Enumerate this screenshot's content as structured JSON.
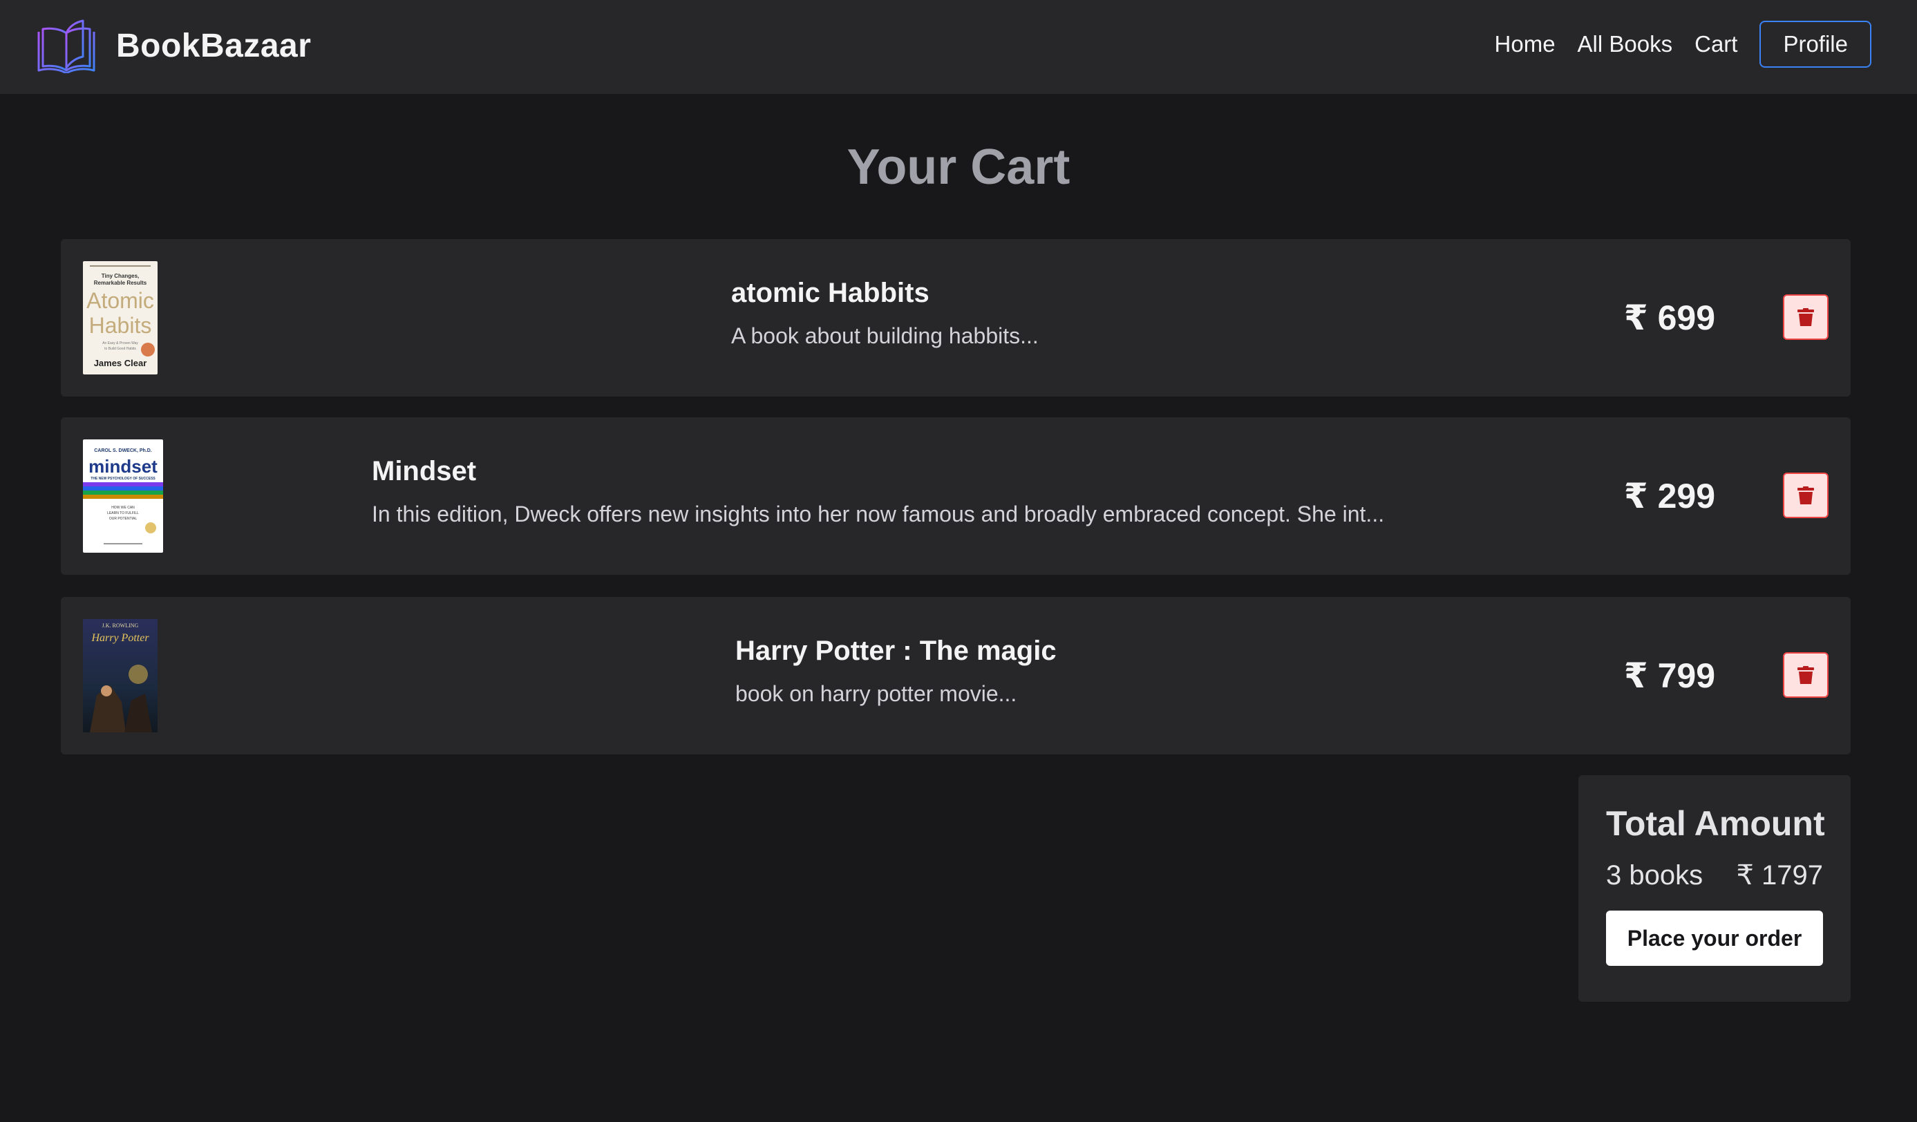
{
  "brand": {
    "name": "BookBazaar",
    "logo_icon": "open-book-icon"
  },
  "nav": {
    "items": [
      {
        "label": "Home"
      },
      {
        "label": "All Books"
      },
      {
        "label": "Cart"
      }
    ],
    "profile_label": "Profile"
  },
  "page": {
    "title": "Your Cart"
  },
  "cart": {
    "items": [
      {
        "title": "atomic Habbits",
        "description": "A book about building habbits...",
        "price": "₹ 699",
        "cover": {
          "top_line": "Tiny Changes, Remarkable Results",
          "title_line1": "Atomic",
          "title_line2": "Habits",
          "author": "James Clear"
        },
        "delete_icon": "trash-icon"
      },
      {
        "title": "Mindset",
        "description": "In this edition, Dweck offers new insights into her now famous and broadly embraced concept. She int...",
        "price": "₹ 299",
        "cover": {
          "author": "CAROL S. DWECK, Ph.D.",
          "title": "mindset",
          "subtitle": "THE NEW PSYCHOLOGY OF SUCCESS"
        },
        "delete_icon": "trash-icon"
      },
      {
        "title": "Harry Potter : The magic",
        "description": "book on harry potter movie...",
        "price": "₹ 799",
        "cover": {
          "author": "J.K. ROWLING",
          "title": "Harry Potter"
        },
        "delete_icon": "trash-icon"
      }
    ]
  },
  "summary": {
    "title": "Total Amount",
    "count_label": "3 books",
    "total_label": "₹ 1797",
    "order_button": "Place your order"
  },
  "colors": {
    "page_bg": "#18181b",
    "card_bg": "#27272a",
    "profile_border": "#3b82f6",
    "delete_bg": "#fee2e2",
    "delete_icon": "#b91c1c"
  }
}
